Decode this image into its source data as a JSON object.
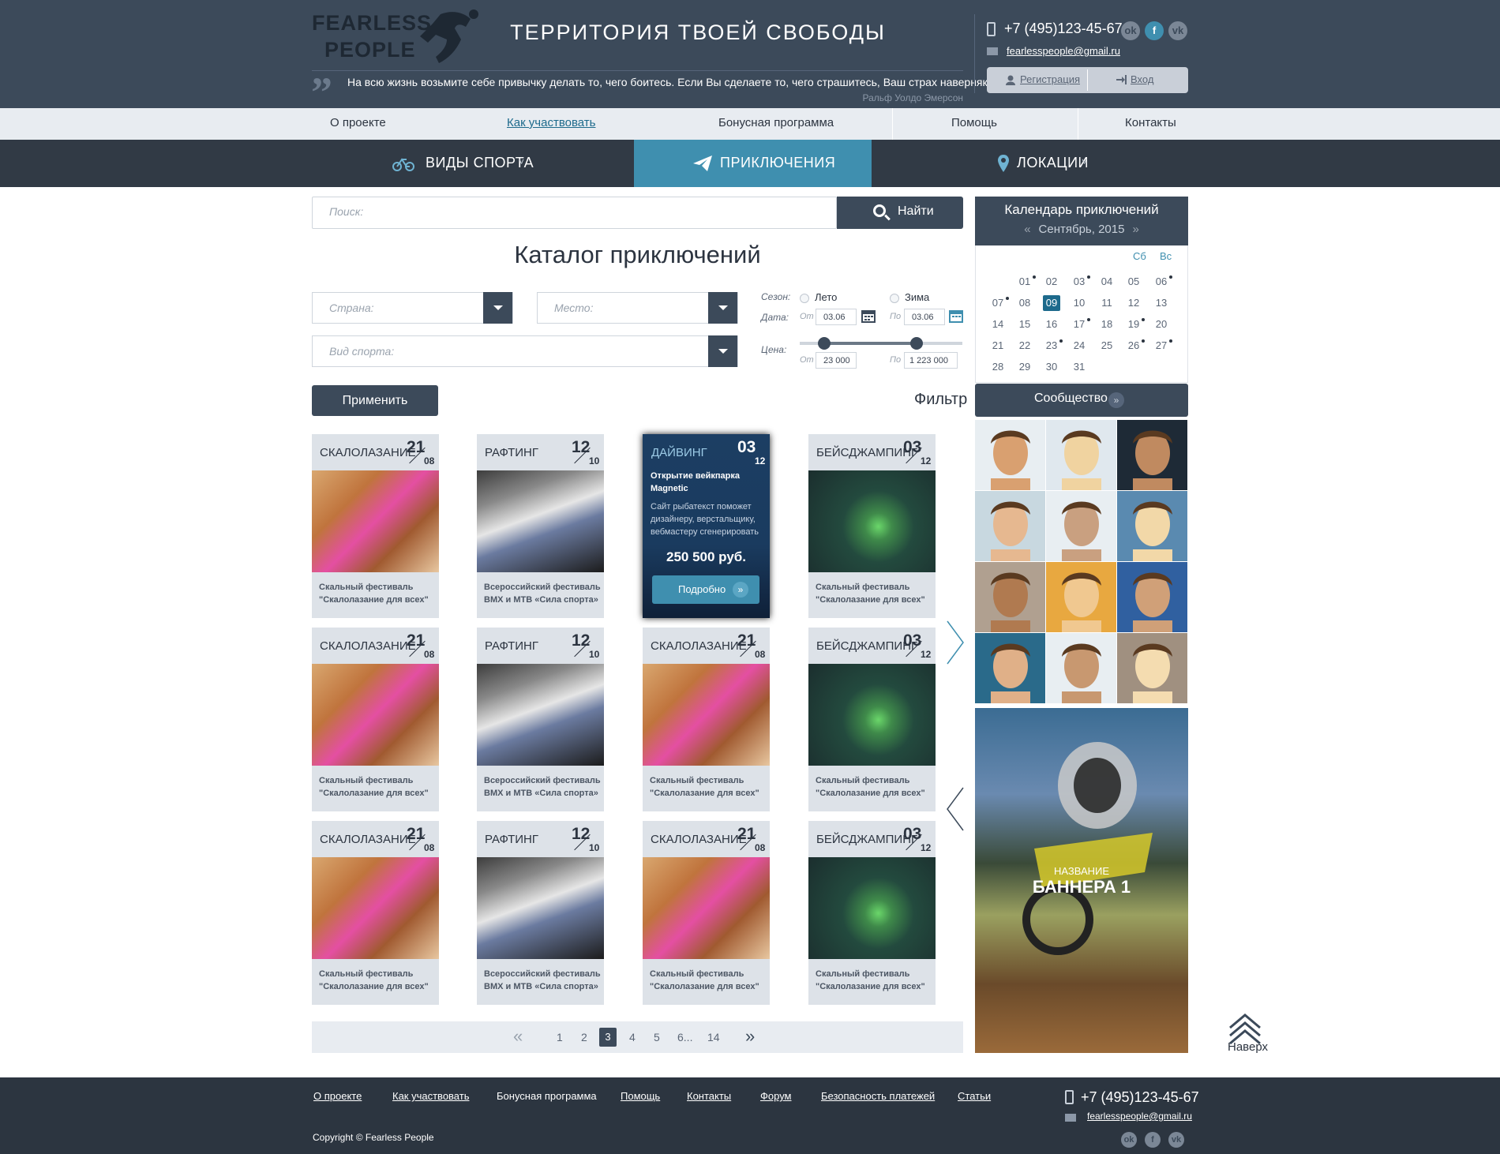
{
  "header": {
    "logo_line1": "FEARLESS",
    "logo_line2": "PEOPLE",
    "slogan": "ТЕРРИТОРИЯ ТВОЕЙ СВОБОДЫ",
    "quote": "На всю жизнь возьмите себе привычку делать то, чего боитесь. Если Вы сделаете то, чего страшитесь, Ваш страх наверняка умрёт.",
    "quote_author": "Ральф Уолдо Эмерсон",
    "phone": "+7 (495)123-45-67",
    "email": "fearlesspeople@gmail.ru",
    "social": [
      {
        "name": "odnoklassniki-icon",
        "glyph": "ok"
      },
      {
        "name": "facebook-icon",
        "glyph": "f"
      },
      {
        "name": "vk-icon",
        "glyph": "vk"
      }
    ],
    "register_label": "Регистрация",
    "login_label": "Вход"
  },
  "top_nav": [
    "О проекте",
    "Как участвовать",
    "Бонусная программа",
    "Помощь",
    "Контакты"
  ],
  "main_nav": {
    "sports": "ВИДЫ СПОРТА",
    "adventures": "ПРИКЛЮЧЕНИЯ",
    "locations": "ЛОКАЦИИ"
  },
  "search": {
    "placeholder": "Поиск:",
    "button": "Найти"
  },
  "catalog_title": "Каталог приключений",
  "filters": {
    "country_placeholder": "Страна:",
    "place_placeholder": "Место:",
    "sport_placeholder": "Вид спорта:",
    "season_label": "Сезон:",
    "summer": "Лето",
    "winter": "Зима",
    "date_label": "Дата:",
    "from": "От",
    "to": "По",
    "date_from": "03.06",
    "date_to": "03.06",
    "price_label": "Цена:",
    "price_from": "23 000",
    "price_to": "1 223 000",
    "apply": "Применить",
    "filter": "Фильтр"
  },
  "cards": [
    {
      "cat": "СКАЛОЛАЗАНИЕ",
      "day": "21",
      "month": "08",
      "img": "climb",
      "desc1": "Скальный фестиваль",
      "desc2": "\"Скалолазание для всех\""
    },
    {
      "cat": "РАФТИНГ",
      "day": "12",
      "month": "10",
      "img": "raft",
      "desc1": "Всероссийский фестиваль",
      "desc2": "BMX и MTB «Сила спорта»"
    },
    {
      "cat": "БЕЙСДЖАМПИНГ",
      "day": "03",
      "month": "12",
      "img": "jump",
      "desc1": "Скальный фестиваль",
      "desc2": "\"Скалолазание для всех\""
    },
    {
      "cat": "СКАЛОЛАЗАНИЕ",
      "day": "21",
      "month": "08",
      "img": "climb",
      "desc1": "Скальный фестиваль",
      "desc2": "\"Скалолазание для всех\""
    },
    {
      "cat": "РАФТИНГ",
      "day": "12",
      "month": "10",
      "img": "raft",
      "desc1": "Всероссийский фестиваль",
      "desc2": "BMX и MTB «Сила спорта»"
    },
    {
      "cat": "СКАЛОЛАЗАНИЕ",
      "day": "21",
      "month": "08",
      "img": "climb",
      "desc1": "Скальный фестиваль",
      "desc2": "\"Скалолазание для всех\""
    },
    {
      "cat": "БЕЙСДЖАМПИНГ",
      "day": "03",
      "month": "12",
      "img": "jump",
      "desc1": "Скальный фестиваль",
      "desc2": "\"Скалолазание для всех\""
    },
    {
      "cat": "СКАЛОЛАЗАНИЕ",
      "day": "21",
      "month": "08",
      "img": "climb",
      "desc1": "Скальный фестиваль",
      "desc2": "\"Скалолазание для всех\""
    },
    {
      "cat": "РАФТИНГ",
      "day": "12",
      "month": "10",
      "img": "raft",
      "desc1": "Всероссийский фестиваль",
      "desc2": "BMX и MTB «Сила спорта»"
    },
    {
      "cat": "СКАЛОЛАЗАНИЕ",
      "day": "21",
      "month": "08",
      "img": "climb",
      "desc1": "Скальный фестиваль",
      "desc2": "\"Скалолазание для всех\""
    },
    {
      "cat": "БЕЙСДЖАМПИНГ",
      "day": "03",
      "month": "12",
      "img": "jump",
      "desc1": "Скальный фестиваль",
      "desc2": "\"Скалолазание для всех\""
    }
  ],
  "featured": {
    "cat": "ДАЙВИНГ",
    "day": "03",
    "month": "12",
    "title": "Открытие вейкпарка Magnetic",
    "text": "Сайт рыбатекст поможет дизайнеру, верстальщику, вебмастеру сгенерировать",
    "price": "250 500 руб.",
    "button": "Подробно"
  },
  "pagination": {
    "pages": [
      "1",
      "2",
      "3",
      "4",
      "5",
      "6...",
      "14"
    ],
    "current": "3"
  },
  "calendar": {
    "title": "Календарь приключений",
    "month": "Сентябрь, 2015",
    "prev": "«",
    "next": "»",
    "dow": [
      "Сб",
      "Вс"
    ],
    "weeks": [
      [
        "",
        "",
        "01",
        "02",
        "03",
        "04",
        "05",
        "06"
      ],
      [
        "07",
        "08",
        "09",
        "10",
        "11",
        "12",
        "13"
      ],
      [
        "14",
        "15",
        "16",
        "17",
        "18",
        "19",
        "20"
      ],
      [
        "21",
        "22",
        "23",
        "24",
        "25",
        "26",
        "27"
      ],
      [
        "28",
        "29",
        "30",
        "31"
      ]
    ],
    "today": "09",
    "event_days": [
      "01",
      "03",
      "06",
      "07",
      "17",
      "19",
      "23",
      "26",
      "27"
    ]
  },
  "community": {
    "label": "Сообщество",
    "arrow": "»"
  },
  "banner": {
    "small": "НАЗВАНИЕ",
    "big": "БАННЕРА 1"
  },
  "to_top": "Наверх",
  "footer": {
    "nav": [
      "О проекте",
      "Как участвовать",
      "Бонусная программа",
      "Помощь",
      "Контакты",
      "Форум",
      "Безопасность платежей",
      "Статьи"
    ],
    "phone": "+7 (495)123-45-67",
    "email": "fearlesspeople@gmail.ru",
    "copyright": "Copyright © Fearless People"
  },
  "colors": {
    "header": "#3c4a5a",
    "accent": "#3f8faf",
    "footer": "#2c3540",
    "today": "#1d6a8c"
  }
}
